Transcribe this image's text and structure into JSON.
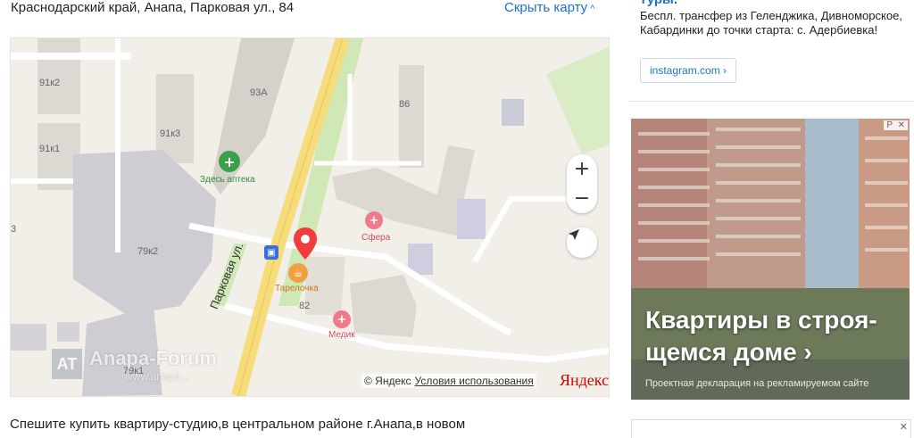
{
  "address": "Краснодарский край, Анапа, Парковая ул., 84",
  "hide_map": {
    "label": "Скрыть карту",
    "icon": "chevron-up-icon"
  },
  "map": {
    "labels": {
      "b91k2": "91к2",
      "b91k1": "91к1",
      "b91k3": "91к3",
      "b93a": "93А",
      "b86": "86",
      "b79k2": "79к2",
      "b79k1": "79к1",
      "b82": "82",
      "b3": "3",
      "street": "Парковая ул."
    },
    "pois": {
      "apteka": "Здесь аптека",
      "sfera": "Сфера",
      "tarelochka": "Тарелочка",
      "medik": "Медик"
    },
    "controls": {
      "zoom_in": "+",
      "zoom_out": "−"
    },
    "copyright": "© Яндекс",
    "terms": "Условия использования",
    "yandex_logo": "Яндекс",
    "watermark": {
      "logo": "AT",
      "title": "Anapa-Forum",
      "url": "www.anapa..."
    },
    "colors": {
      "road_main": "#f6dc7a",
      "park": "#cfe8b5",
      "building": "#dcd8d2",
      "marker": "#f23c3c"
    }
  },
  "bottom_text": "Спешите купить квартиру-студию,в центральном районе г.Анапа,в новом",
  "ad1": {
    "title": "туры.",
    "description": "Беспл. трансфер из Геленджика, Дивноморское, Кабардинки до точки старта: с. Адербиевка!",
    "link": "instagram.com ›"
  },
  "ad2": {
    "headline": "Квартиры в строя­щемся доме ›",
    "subtext": "Проектная декларация на рекламируемом сайте",
    "ad_mark": "Р",
    "close": "✕"
  },
  "ad3": {
    "close": "✕"
  }
}
